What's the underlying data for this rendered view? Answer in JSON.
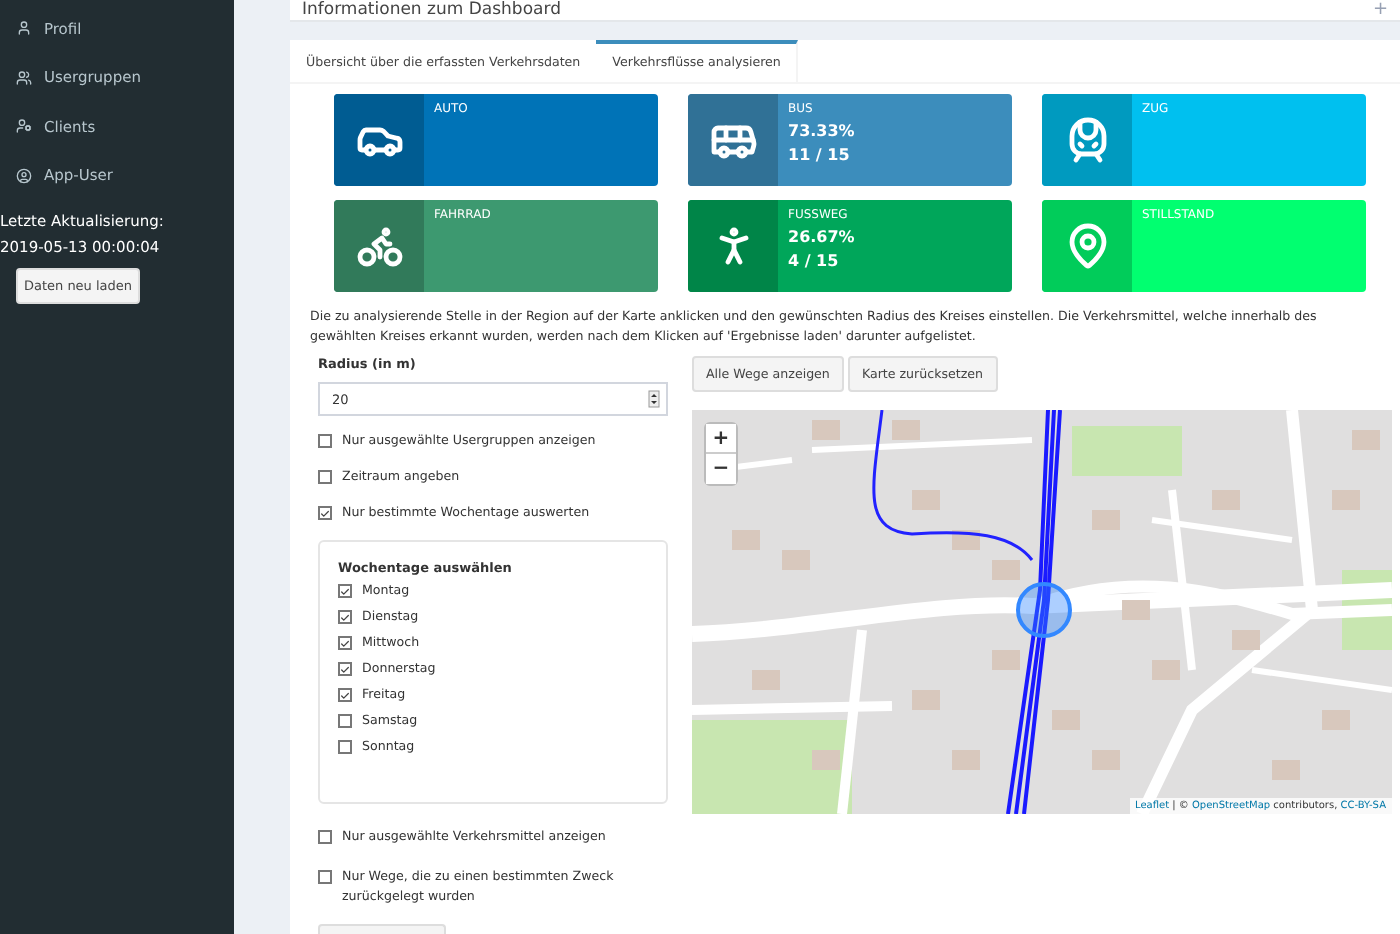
{
  "sidebar": {
    "items": [
      {
        "kind": "user",
        "label": "Profil"
      },
      {
        "kind": "users",
        "label": "Usergruppen"
      },
      {
        "kind": "client",
        "label": "Clients"
      },
      {
        "kind": "appuser",
        "label": "App-User"
      }
    ],
    "update_label": "Letzte Aktualisierung:",
    "update_time": "2019-05-13 00:00:04",
    "reload_button": "Daten neu laden"
  },
  "header": {
    "title": "Informationen zum Dashboard",
    "action": "+"
  },
  "tabs": [
    {
      "label": "Übersicht über die erfassten Verkehrsdaten",
      "selected": false
    },
    {
      "label": "Verkehrsflüsse analysieren",
      "selected": true
    }
  ],
  "cards": [
    {
      "kind": "car",
      "title": "AUTO",
      "color": "#0073b7"
    },
    {
      "kind": "bus",
      "title": "BUS",
      "percent": "73.33%",
      "count": "11 / 15",
      "color": "#3c8dbc"
    },
    {
      "kind": "train",
      "title": "ZUG",
      "color": "#00c0ef"
    },
    {
      "kind": "bike",
      "title": "FAHRRAD",
      "color": "#3d9970"
    },
    {
      "kind": "walk",
      "title": "FUSSWEG",
      "percent": "26.67%",
      "count": "4 / 15",
      "color": "#00a65a"
    },
    {
      "kind": "pin",
      "title": "STILLSTAND",
      "color": "#01ff70"
    }
  ],
  "description": "Die zu analysierende Stelle in der Region auf der Karte anklicken und den gewünschten Radius des Kreises einstellen. Die Verkehrsmittel, welche innerhalb des gewählten Kreises erkannt wurden, werden nach dem Klicken auf 'Ergebnisse laden' darunter aufgelistet.",
  "radius": {
    "label": "Radius (in m)",
    "value": "20"
  },
  "options_top": [
    {
      "label": "Nur ausgewählte Usergruppen anzeigen",
      "checked": false
    },
    {
      "label": "Zeitraum angeben",
      "checked": false
    },
    {
      "label": "Nur bestimmte Wochentage auswerten",
      "checked": true
    }
  ],
  "weekdays": {
    "title": "Wochentage auswählen",
    "days": [
      {
        "label": "Montag",
        "checked": true
      },
      {
        "label": "Dienstag",
        "checked": true
      },
      {
        "label": "Mittwoch",
        "checked": true
      },
      {
        "label": "Donnerstag",
        "checked": true
      },
      {
        "label": "Freitag",
        "checked": true
      },
      {
        "label": "Samstag",
        "checked": false
      },
      {
        "label": "Sonntag",
        "checked": false
      }
    ]
  },
  "options_bottom": [
    {
      "label": "Nur ausgewählte Verkehrsmittel anzeigen",
      "checked": false
    },
    {
      "label": "Nur Wege, die zu einen bestimmten Zweck zurückgelegt wurden",
      "checked": false
    }
  ],
  "map_buttons": [
    "Alle Wege anzeigen",
    "Karte zurücksetzen"
  ],
  "map": {
    "zoom_in": "+",
    "zoom_out": "−",
    "attribution": [
      {
        "kind": "link",
        "text": "Leaflet"
      },
      {
        "kind": "text",
        "text": " | © "
      },
      {
        "kind": "link",
        "text": "OpenStreetMap"
      },
      {
        "kind": "text",
        "text": " contributors, "
      },
      {
        "kind": "link",
        "text": "CC-BY-SA"
      }
    ]
  }
}
